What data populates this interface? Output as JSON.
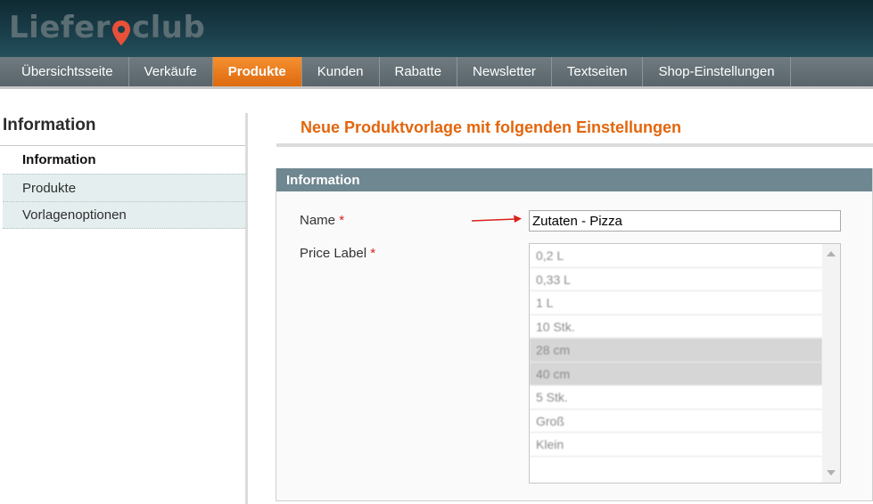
{
  "logo": {
    "text_left": "Liefer",
    "text_right": "club",
    "pin_icon": "map-pin-icon",
    "pin_color": "#e8503a"
  },
  "nav": {
    "items": [
      {
        "label": "Übersichtsseite"
      },
      {
        "label": "Verkäufe"
      },
      {
        "label": "Produkte",
        "active": true
      },
      {
        "label": "Kunden"
      },
      {
        "label": "Rabatte"
      },
      {
        "label": "Newsletter"
      },
      {
        "label": "Textseiten"
      },
      {
        "label": "Shop-Einstellungen"
      }
    ],
    "active_color": "#e8751a"
  },
  "sidebar": {
    "title": "Information",
    "items": [
      {
        "label": "Information"
      },
      {
        "label": "Produkte"
      },
      {
        "label": "Vorlagenoptionen"
      }
    ]
  },
  "main": {
    "heading": "Neue Produktvorlage mit folgenden Einstellungen",
    "heading_color": "#e2660d",
    "section_title": "Information",
    "fields": {
      "name_label": "Name",
      "name_value": "Zutaten - Pizza",
      "price_label": "Price Label",
      "required_mark": "*",
      "price_options": [
        "0,2 L",
        "0,33 L",
        "1 L",
        "10 Stk.",
        "28 cm",
        "40 cm",
        "5 Stk.",
        "Groß",
        "Klein"
      ],
      "selected_options": [
        "28 cm",
        "40 cm"
      ]
    }
  }
}
